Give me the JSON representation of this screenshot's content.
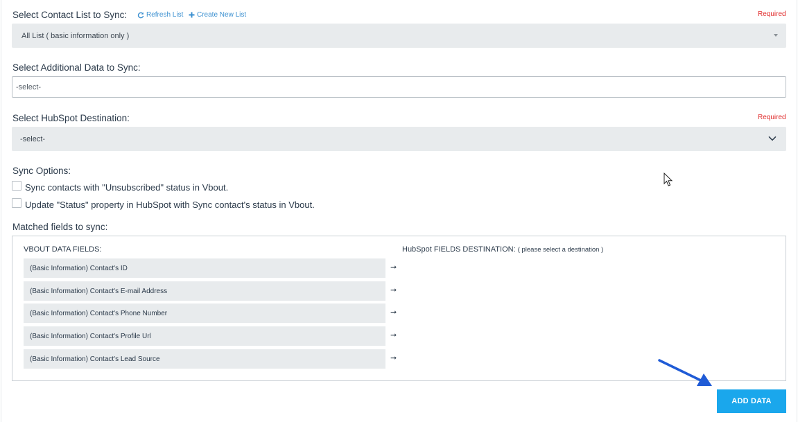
{
  "contact_list": {
    "label": "Select Contact List to Sync:",
    "refresh_label": "Refresh List",
    "create_label": "Create New List",
    "required": "Required",
    "value": "All List ( basic information only )"
  },
  "additional_data": {
    "label": "Select Additional Data to Sync:",
    "placeholder": "-select-"
  },
  "destination": {
    "label": "Select HubSpot Destination:",
    "required": "Required",
    "value": "-select-"
  },
  "sync_options": {
    "label": "Sync Options:",
    "options": [
      {
        "label": "Sync contacts with \"Unsubscribed\" status in Vbout.",
        "checked": false
      },
      {
        "label": "Update \"Status\" property in HubSpot with Sync contact's status in Vbout.",
        "checked": false
      }
    ]
  },
  "matched_fields": {
    "label": "Matched fields to sync:",
    "vbout_header": "VBOUT DATA FIELDS:",
    "hubspot_header": "HubSpot FIELDS DESTINATION:",
    "hubspot_hint": "( please select a destination )",
    "arrow": "➞",
    "fields": [
      "(Basic Information) Contact's ID",
      "(Basic Information) Contact's E-mail Address",
      "(Basic Information) Contact's Phone Number",
      "(Basic Information) Contact's Profile Url",
      "(Basic Information) Contact's Lead Source"
    ]
  },
  "add_button": {
    "label": "ADD DATA"
  },
  "colors": {
    "accent": "#1aa7ec",
    "link": "#3a8fd0",
    "required": "#e02b2b",
    "annotation_arrow": "#1f5bd6"
  },
  "icons": [
    "refresh-icon",
    "plus-icon",
    "caret-down-icon",
    "chevron-down-icon",
    "right-arrow-icon",
    "mouse-cursor-icon",
    "annotation-arrow-icon"
  ]
}
